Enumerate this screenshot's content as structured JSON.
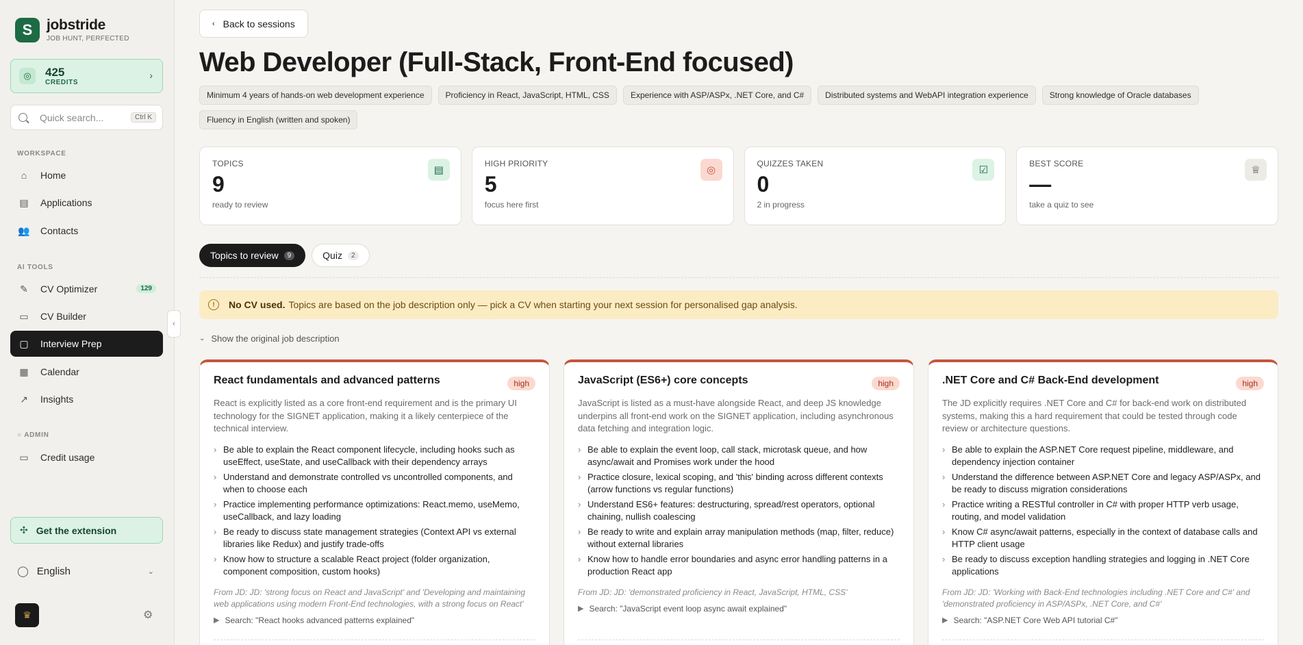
{
  "brand": {
    "name": "jobstride",
    "tagline": "JOB HUNT, PERFECTED",
    "logo_glyph": "S"
  },
  "credits": {
    "amount": "425",
    "label": "CREDITS"
  },
  "search": {
    "placeholder": "Quick search...",
    "shortcut": "Ctrl K"
  },
  "nav": {
    "workspace_label": "WORKSPACE",
    "workspace_items": [
      {
        "label": "Home",
        "icon": "home-icon"
      },
      {
        "label": "Applications",
        "icon": "document-icon"
      },
      {
        "label": "Contacts",
        "icon": "users-icon"
      }
    ],
    "ai_label": "AI TOOLS",
    "ai_items": [
      {
        "label": "CV Optimizer",
        "icon": "wand-icon",
        "badge": "129"
      },
      {
        "label": "CV Builder",
        "icon": "file-icon"
      },
      {
        "label": "Interview Prep",
        "icon": "chat-icon",
        "active": true
      },
      {
        "label": "Calendar",
        "icon": "calendar-icon"
      },
      {
        "label": "Insights",
        "icon": "chart-icon"
      }
    ],
    "admin_label": "ADMIN",
    "admin_items": [
      {
        "label": "Credit usage",
        "icon": "credit-card-icon"
      }
    ]
  },
  "extension": {
    "label": "Get the extension"
  },
  "language": {
    "label": "English"
  },
  "back": {
    "label": "Back to sessions"
  },
  "page": {
    "title": "Web Developer (Full-Stack, Front-End focused)"
  },
  "requirements": [
    "Minimum 4 years of hands-on web development experience",
    "Proficiency in React, JavaScript, HTML, CSS",
    "Experience with ASP/ASPx, .NET Core, and C#",
    "Distributed systems and WebAPI integration experience",
    "Strong knowledge of Oracle databases",
    "Fluency in English (written and spoken)"
  ],
  "stats": [
    {
      "label": "TOPICS",
      "value": "9",
      "sub": "ready to review",
      "icon": "clipboard-icon",
      "color": "#1c6b44",
      "bg": "#dcf2e4"
    },
    {
      "label": "HIGH PRIORITY",
      "value": "5",
      "sub": "focus here first",
      "icon": "target-icon",
      "color": "#c4553b",
      "bg": "#fbd9d0"
    },
    {
      "label": "QUIZZES TAKEN",
      "value": "0",
      "sub": "2 in progress",
      "icon": "checklist-icon",
      "color": "#1c6b44",
      "bg": "#dcf2e4"
    },
    {
      "label": "BEST SCORE",
      "value": "—",
      "sub": "take a quiz to see",
      "icon": "trophy-icon",
      "color": "#444",
      "bg": "#ecebe6"
    }
  ],
  "tabs": [
    {
      "label": "Topics to review",
      "count": "9",
      "active": true
    },
    {
      "label": "Quiz",
      "count": "2",
      "active": false
    }
  ],
  "notice": {
    "bold": "No CV used.",
    "text": "Topics are based on the job description only — pick a CV when starting your next session for personalised gap analysis."
  },
  "jd_toggle": {
    "label": "Show the original job description"
  },
  "cards": [
    {
      "title": "React fundamentals and advanced patterns",
      "priority": "high",
      "desc": "React is explicitly listed as a core front-end requirement and is the primary UI technology for the SIGNET application, making it a likely centerpiece of the technical interview.",
      "bullets": [
        "Be able to explain the React component lifecycle, including hooks such as useEffect, useState, and useCallback with their dependency arrays",
        "Understand and demonstrate controlled vs uncontrolled components, and when to choose each",
        "Practice implementing performance optimizations: React.memo, useMemo, useCallback, and lazy loading",
        "Be ready to discuss state management strategies (Context API vs external libraries like Redux) and justify trade-offs",
        "Know how to structure a scalable React project (folder organization, component composition, custom hooks)"
      ],
      "from_jd": "From JD: JD: 'strong focus on React and JavaScript' and 'Developing and maintaining web applications using modern Front-End technologies, with a strong focus on React'",
      "search": "Search: \"React hooks advanced patterns explained\""
    },
    {
      "title": "JavaScript (ES6+) core concepts",
      "priority": "high",
      "desc": "JavaScript is listed as a must-have alongside React, and deep JS knowledge underpins all front-end work on the SIGNET application, including asynchronous data fetching and integration logic.",
      "bullets": [
        "Be able to explain the event loop, call stack, microtask queue, and how async/await and Promises work under the hood",
        "Practice closure, lexical scoping, and 'this' binding across different contexts (arrow functions vs regular functions)",
        "Understand ES6+ features: destructuring, spread/rest operators, optional chaining, nullish coalescing",
        "Be ready to write and explain array manipulation methods (map, filter, reduce) without external libraries",
        "Know how to handle error boundaries and async error handling patterns in a production React app"
      ],
      "from_jd": "From JD: JD: 'demonstrated proficiency in React, JavaScript, HTML, CSS'",
      "search": "Search: \"JavaScript event loop async await explained\""
    },
    {
      "title": ".NET Core and C# Back-End development",
      "priority": "high",
      "desc": "The JD explicitly requires .NET Core and C# for back-end work on distributed systems, making this a hard requirement that could be tested through code review or architecture questions.",
      "bullets": [
        "Be able to explain the ASP.NET Core request pipeline, middleware, and dependency injection container",
        "Understand the difference between ASP.NET Core and legacy ASP/ASPx, and be ready to discuss migration considerations",
        "Practice writing a RESTful controller in C# with proper HTTP verb usage, routing, and model validation",
        "Know C# async/await patterns, especially in the context of database calls and HTTP client usage",
        "Be ready to discuss exception handling strategies and logging in .NET Core applications"
      ],
      "from_jd": "From JD: JD: 'Working with Back-End technologies including .NET Core and C#' and 'demonstrated proficiency in ASP/ASPx, .NET Core, and C#'",
      "search": "Search: \"ASP.NET Core Web API tutorial C#\""
    }
  ]
}
